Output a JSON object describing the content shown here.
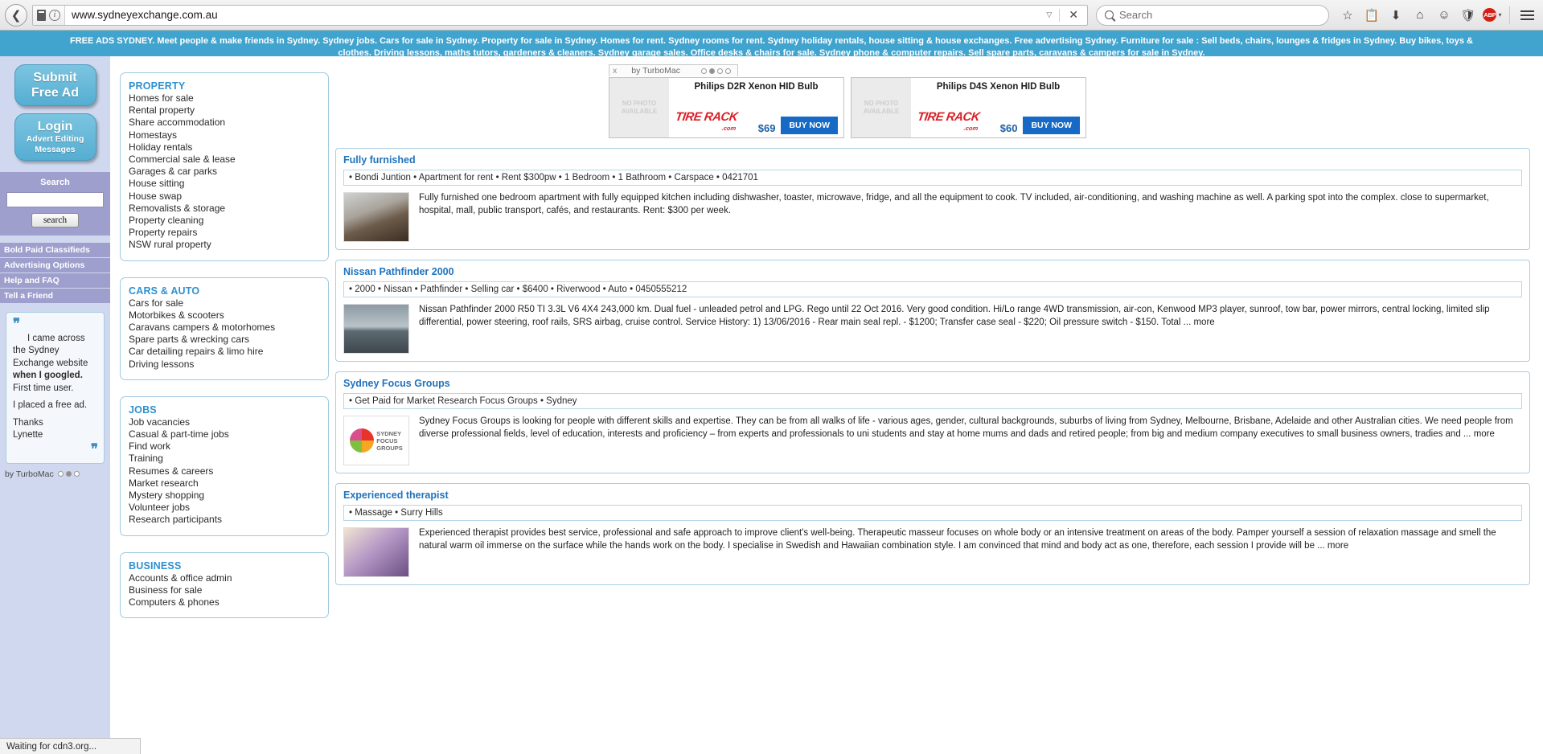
{
  "browser": {
    "back_icon": "back-arrow-icon",
    "url": "www.sydneyexchange.com.au",
    "search_placeholder": "Search",
    "dropdown_glyph": "▽",
    "stop_glyph": "✕",
    "toolbar_icons": [
      "star-icon",
      "clipboard-icon",
      "download-icon",
      "home-icon",
      "smiley-icon",
      "shield-icon",
      "adblock-icon",
      "menu-icon"
    ],
    "abp_label": "ABP",
    "status_text": "Waiting for cdn3.org..."
  },
  "banner": {
    "line1": "FREE ADS SYDNEY. Meet people & make friends in Sydney. Sydney jobs. Cars for sale in Sydney. Property for sale in Sydney. Homes for rent. Sydney rooms for rent. Sydney holiday rentals, house sitting & house exchanges. Free advertising Sydney. Furniture for sale : Sell beds, chairs, lounges & fridges in Sydney. Buy bikes, toys &",
    "line2": "clothes. Driving lessons, maths tutors, gardeners & cleaners. Sydney garage sales. Office desks & chairs for sale. Sydney phone & computer repairs. Sell spare parts, caravans & campers for sale in Sydney."
  },
  "sidebar": {
    "submit_button": {
      "line1": "Submit",
      "line2": "Free Ad"
    },
    "login_button": {
      "line1": "Login",
      "line2": "Advert Editing",
      "line3": "Messages"
    },
    "search": {
      "label": "Search",
      "value": "",
      "button": "search"
    },
    "menu": [
      "Bold Paid Classifieds",
      "Advertising Options",
      "Help and FAQ",
      "Tell a Friend"
    ],
    "testimonial": {
      "open_quote": "❞",
      "close_quote": "❞",
      "p1": "I came across the Sydney Exchange website ",
      "p1_bold": "when I googled.",
      "p1_tail": " First time user.",
      "p2": "I placed a free ad.",
      "p3": "Thanks",
      "p4": "Lynette"
    },
    "byline": "by TurboMac"
  },
  "categories": [
    {
      "title": "PROPERTY",
      "items": [
        "Homes for sale",
        "Rental property",
        "Share accommodation",
        "Homestays",
        "Holiday rentals",
        "Commercial sale & lease",
        "Garages & car parks",
        "House sitting",
        "House swap",
        "Removalists & storage",
        "Property cleaning",
        "Property repairs",
        "NSW rural property"
      ]
    },
    {
      "title": "CARS & AUTO",
      "items": [
        "Cars for sale",
        "Motorbikes & scooters",
        "Caravans campers & motorhomes",
        "Spare parts & wrecking cars",
        "Car detailing repairs & limo hire",
        "Driving lessons"
      ]
    },
    {
      "title": "JOBS",
      "items": [
        "Job vacancies",
        "Casual & part-time jobs",
        "Find work",
        "Training",
        "Resumes & careers",
        "Market research",
        "Mystery shopping",
        "Volunteer jobs",
        "Research participants"
      ]
    },
    {
      "title": "BUSINESS",
      "items": [
        "Accounts & office admin",
        "Business for sale",
        "Computers & phones"
      ]
    }
  ],
  "top_ad": {
    "header_label": "by TurboMac",
    "close_glyph": "x",
    "no_photo": "NO PHOTO AVAILABLE",
    "brand": "TIRE RACK",
    "brand_tld": ".com",
    "cards": [
      {
        "title": "Philips D2R Xenon HID Bulb",
        "price": "$69",
        "cta": "BUY NOW"
      },
      {
        "title": "Philips D4S Xenon HID Bulb",
        "price": "$60",
        "cta": "BUY NOW"
      }
    ]
  },
  "listings": [
    {
      "title": "Fully furnished",
      "meta": "• Bondi Juntion • Apartment for rent • Rent $300pw • 1 Bedroom • 1 Bathroom • Carspace • 0421701",
      "desc": "Fully furnished one bedroom apartment with fully equipped kitchen including dishwasher, toaster, microwave, fridge, and all the equipment to cook. TV included, air-conditioning, and washing machine as well. A parking spot into the complex. close to supermarket, hospital, mall, public transport, cafés, and restaurants. Rent: $300 per week.",
      "thumb": "apartment-photo"
    },
    {
      "title": "Nissan Pathfinder 2000",
      "meta": "• 2000 • Nissan • Pathfinder • Selling car • $6400 • Riverwood • Auto • 0450555212",
      "desc": "Nissan Pathfinder 2000 R50 TI 3.3L V6 4X4 243,000 km. Dual fuel - unleaded petrol and LPG. Rego until 22 Oct 2016. Very good condition. Hi/Lo range 4WD transmission, air-con, Kenwood MP3 player, sunroof, tow bar, power mirrors, central locking, limited slip differential, power steering, roof rails, SRS airbag, cruise control. Service History: 1) 13/06/2016 - Rear main seal repl. - $1200; Transfer case seal - $220; Oil pressure switch - $150. Total ... more",
      "thumb": "car-photo"
    },
    {
      "title": "Sydney Focus Groups",
      "meta": "• Get Paid for Market Research Focus Groups • Sydney",
      "desc": "Sydney Focus Groups is looking for people with different skills and expertise. They can be from all walks of life - various ages, gender, cultural backgrounds, suburbs of living from Sydney, Melbourne, Brisbane, Adelaide and other Australian cities. We need people from diverse professional fields, level of education, interests and proficiency – from experts and professionals to uni students and stay at home mums and dads and retired people; from big and medium company executives to small business owners, tradies and ... more",
      "thumb": "sydney-focus-groups-logo",
      "logo_lines": [
        "SYDNEY",
        "FOCUS",
        "GROUPS"
      ]
    },
    {
      "title": "Experienced therapist",
      "meta": "• Massage • Surry Hills",
      "desc": "Experienced therapist provides best service, professional and safe approach to improve client's well-being. Therapeutic masseur focuses on whole body or an intensive treatment on areas of the body. Pamper yourself a session of relaxation massage and smell the natural warm oil immerse on the surface while the hands work on the body. I specialise in Swedish and Hawaiian combination style. I am convinced that mind and body act as one, therefore, each session I provide will be ... more",
      "thumb": "flower-photo"
    }
  ],
  "colors": {
    "banner_blue": "#40a4cf",
    "sidebar_lavender": "#cfd8ee",
    "menu_purple": "#9f9fce",
    "link_blue": "#2f90cf",
    "title_blue": "#1f72bd",
    "buy_now_blue": "#1669c5",
    "tirerack_red": "#d81f26"
  }
}
